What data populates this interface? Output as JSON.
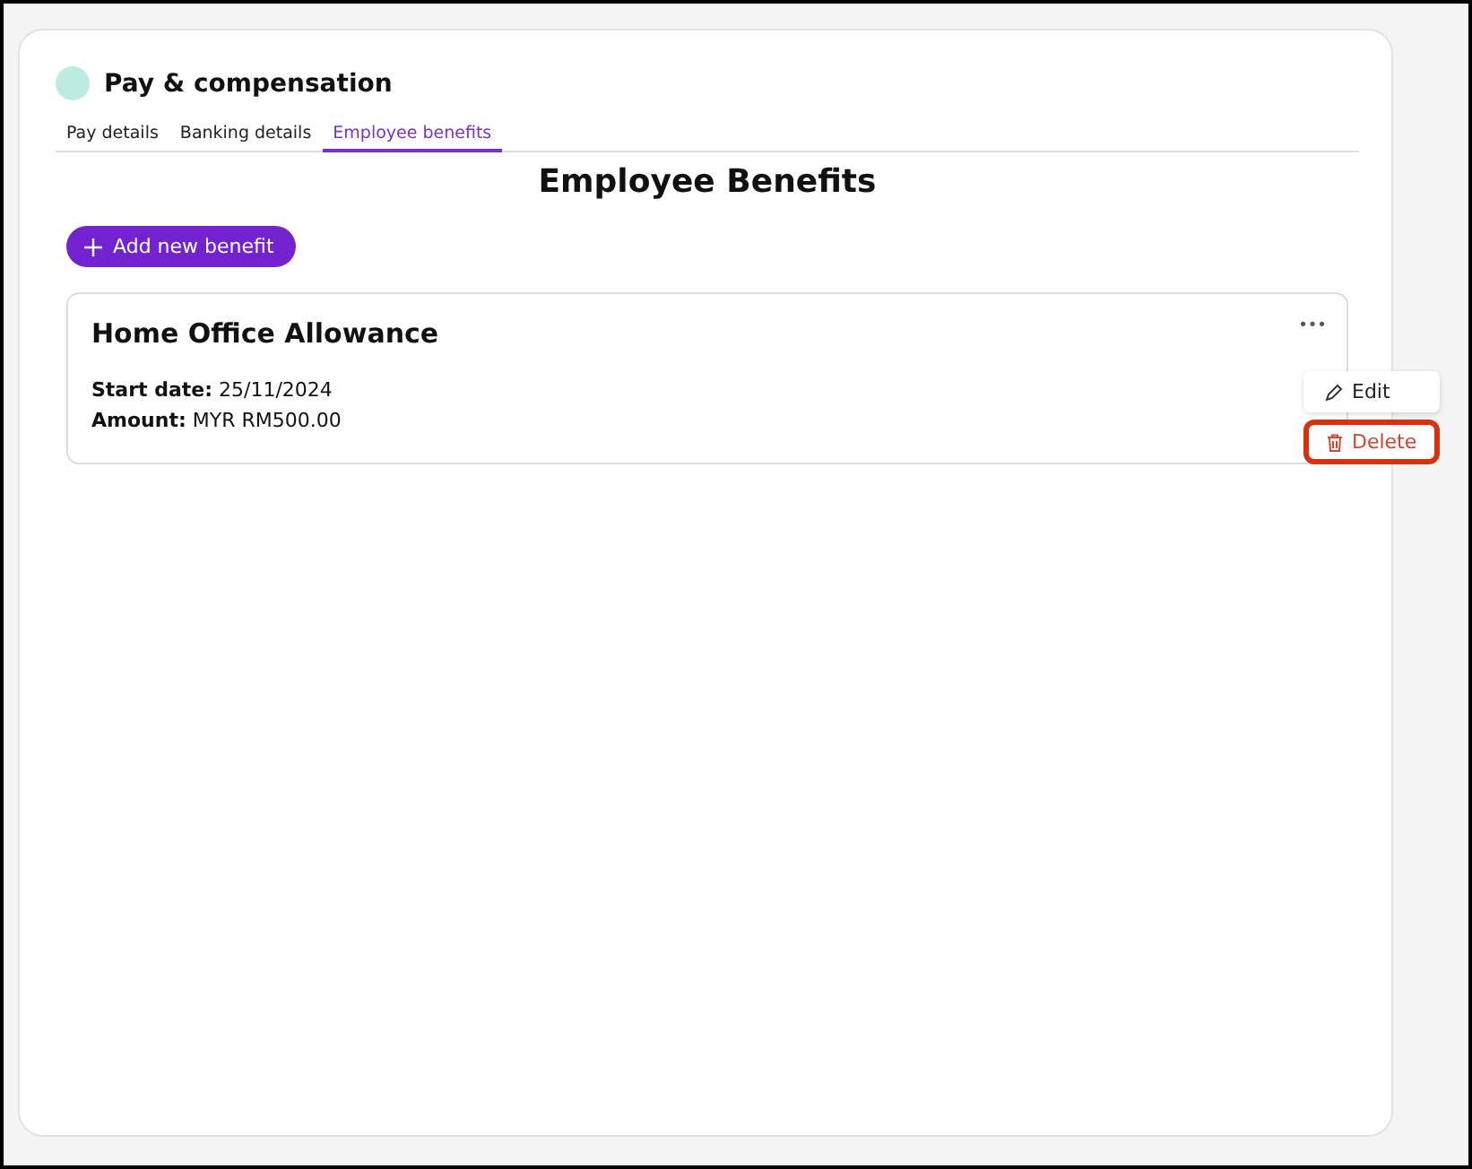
{
  "section": {
    "title": "Pay & compensation"
  },
  "tabs": [
    {
      "label": "Pay details",
      "selected": false
    },
    {
      "label": "Banking details",
      "selected": false
    },
    {
      "label": "Employee benefits",
      "selected": true
    }
  ],
  "heading": "Employee Benefits",
  "add_button": {
    "label": "Add new benefit"
  },
  "benefits": [
    {
      "title": "Home Office Allowance",
      "more": "•••",
      "details": [
        "**Start date:** 25/11/2024",
        "**Amount:** MYR RM500.00"
      ]
    }
  ],
  "menu": {
    "items": [
      {
        "label": "Edit",
        "kind": "edit",
        "highlighted": false
      },
      {
        "label": "Delete",
        "kind": "delete",
        "highlighted": true
      }
    ]
  }
}
